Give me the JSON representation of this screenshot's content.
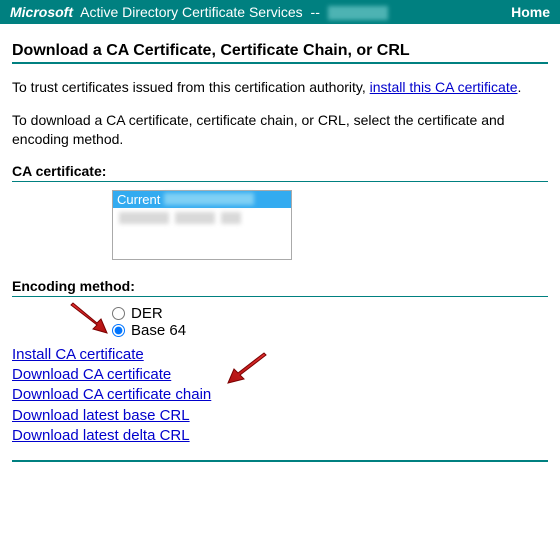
{
  "banner": {
    "brand": "Microsoft",
    "product": "Active Directory Certificate Services",
    "separator": "--",
    "home_label": "Home"
  },
  "page": {
    "title": "Download a CA Certificate, Certificate Chain, or CRL",
    "intro1_prefix": "To trust certificates issued from this certification authority, ",
    "intro1_link": "install this CA certificate",
    "intro1_suffix": ".",
    "intro2": "To download a CA certificate, certificate chain, or CRL, select the certificate and encoding method."
  },
  "ca_section": {
    "label": "CA certificate:",
    "selected_prefix": "Current"
  },
  "encoding_section": {
    "label": "Encoding method:",
    "options": {
      "der": "DER",
      "b64": "Base 64"
    },
    "selected": "b64"
  },
  "actions": {
    "install": "Install CA certificate",
    "download_cert": "Download CA certificate",
    "download_chain": "Download CA certificate chain",
    "download_base_crl": "Download latest base CRL",
    "download_delta_crl": "Download latest delta CRL"
  }
}
